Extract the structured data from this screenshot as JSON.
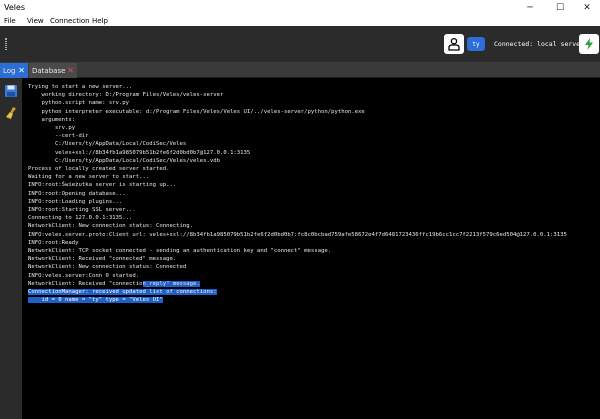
{
  "window": {
    "title": "Veles",
    "minimize": "─",
    "maximize": "☐",
    "close": "✕"
  },
  "menu": [
    "File",
    "View",
    "Connection",
    "Help"
  ],
  "toolbar": {
    "user_name": "ty",
    "connection_status": "Connected: local server",
    "user_icon": "user-icon",
    "connection_icon": "lightning-icon"
  },
  "tabs": [
    {
      "label": "Log",
      "close": "✕"
    },
    {
      "label": "Database",
      "close": "✕"
    }
  ],
  "sidebar": {
    "icons": [
      "save-icon",
      "clear-icon"
    ]
  },
  "log": {
    "lines": [
      "Trying to start a new server...",
      "    working directory: D:/Program Files/Veles/veles-server",
      "    python.script name: srv.py",
      "    python interpreter executable: d:/Program Files/Veles/Veles UI/../veles-server/python/python.exe",
      "    arguments:",
      "        srv.py",
      "        --cert-dir",
      "        C:/Users/ty/AppData/Local/CodiSec/Veles",
      "        veles+ssl://8b34fb1a985079b51b2fe6f2d0bd0b7@127.0.0.1:3135",
      "        C:/Users/ty/AppData/Local/CodiSec/Veles/veles.vdb",
      "",
      "Process of locally created server started.",
      "Waiting for a new server to start...",
      "INFO:root:Świeżutka server is starting up...",
      "INFO:root:Opening database...",
      "INFO:root:Loading plugins...",
      "INFO:root:Starting SSL server...",
      "Connecting to 127.0.0.1:3135...",
      "NetworkClient: New connection status: Connecting.",
      "INFO:veles.server.proto:Client url: veles+ssl://8b34fb1a985079b51b2fe6f2d0bd0b7:fc8c0bcbad759afe58672e4f7d6481723436ffc19b6cc1cc7f2213f579c6ed504@127.0.0.1:3135",
      "INFO:root:Ready",
      "NetworkClient: TCP socket connected - sending an authentication key and \"connect\" message.",
      "NetworkClient: Received \"connected\" message.",
      "NetworkClient: New connection status: Connected",
      "INFO:veles.server:Conn 0 started.",
      "NetworkClient: Received \"connectio",
      "ConnectionManager: received updated list of connections:",
      "    id = 0 name = \"ty\" type = \"Veles UI\""
    ],
    "highlight_suffix": "n_reply\" message."
  }
}
